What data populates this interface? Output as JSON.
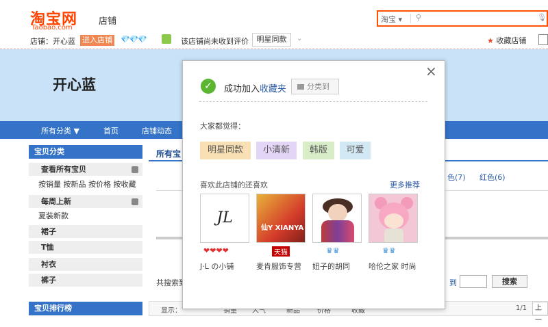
{
  "header": {
    "logo_cn": "淘宝网",
    "logo_en": "Taobao.com",
    "section": "店铺",
    "search_scope": "淘宝",
    "search_placeholder": ""
  },
  "shopbar": {
    "shop_label": "店铺：开心蓝",
    "enter_shop": "进入店铺",
    "rating_note": "该店铺尚未收到评价",
    "style_tag": "明星同款",
    "favorite_shop": "收藏店铺"
  },
  "banner": {
    "shop_name": "开心蓝"
  },
  "nav": {
    "items": [
      "所有分类 ▼",
      "首页",
      "店铺动态"
    ]
  },
  "sidebar": {
    "title": "宝贝分类",
    "view_all": "查看所有宝贝",
    "sort_links": "按销量 按新品 按价格 按收藏",
    "weekly_new": "每周上新",
    "summer_new": "夏装新款",
    "categories": [
      "裙子",
      "T恤",
      "衬衣",
      "裤子"
    ],
    "ranking_title": "宝贝排行榜"
  },
  "main": {
    "title": "所有宝",
    "colors": [
      "色(7)",
      "红色(6)"
    ],
    "total_prefix": "共搜索到",
    "to_label": "到",
    "search_button": "搜索",
    "sort_bar": [
      "显示：",
      "销量",
      "人气",
      "新品",
      "价格",
      "收藏"
    ],
    "page": "1/1",
    "prev": "上一"
  },
  "modal": {
    "success_prefix": "成功加入",
    "success_link": "收藏夹",
    "classify_button": "分类到",
    "everyone_thinks": "大家都觉得：",
    "tags": [
      {
        "label": "明星同款",
        "color": "#f9dfb4"
      },
      {
        "label": "小清新",
        "color": "#e2d5f5"
      },
      {
        "label": "韩版",
        "color": "#d7ecc7"
      },
      {
        "label": "可爱",
        "color": "#d3e8f5"
      }
    ],
    "also_like": "喜欢此店铺的还喜欢",
    "more": "更多推荐",
    "shops": [
      {
        "name": "J·L の小铺",
        "badge": "❤❤❤❤",
        "badge_color": "#e03030",
        "image_text": "JL"
      },
      {
        "name": "麦肯服饰专营",
        "badge": "天猫",
        "badge_color": "#c40000",
        "image_text": "仙Y XIANYA"
      },
      {
        "name": "妞子的胡同",
        "badge": "♛♛",
        "badge_color": "#3a8fd6",
        "image_text": ""
      },
      {
        "name": "哈伦之家 时尚",
        "badge": "♛♛",
        "badge_color": "#3a8fd6",
        "image_text": ""
      }
    ]
  }
}
